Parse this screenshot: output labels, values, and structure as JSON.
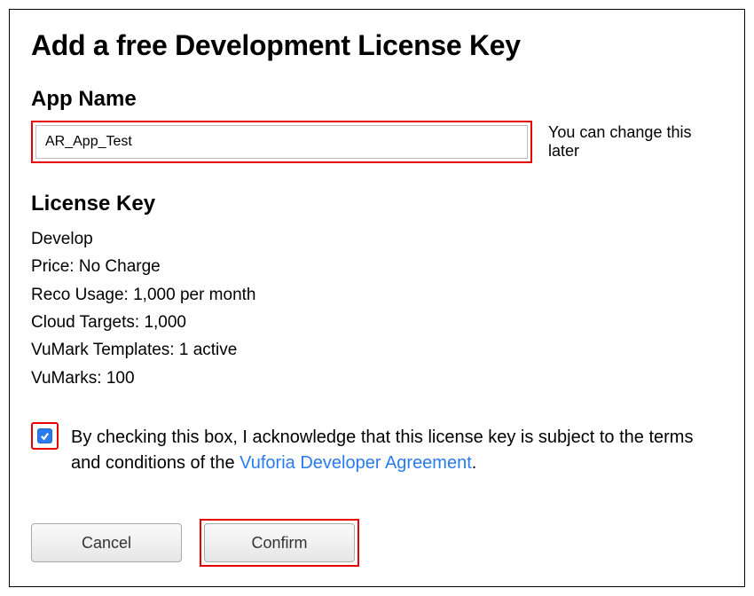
{
  "title": "Add a free Development License Key",
  "appName": {
    "label": "App Name",
    "value": "AR_App_Test",
    "hint": "You can change this later"
  },
  "licenseKey": {
    "label": "License Key",
    "tier": "Develop",
    "price": "Price: No Charge",
    "reco": "Reco Usage: 1,000 per month",
    "cloud": "Cloud Targets: 1,000",
    "vumarkTemplates": "VuMark Templates: 1 active",
    "vumarks": "VuMarks: 100"
  },
  "agreement": {
    "prefix": "By checking this box, I acknowledge that this license key is subject to the terms and conditions of the ",
    "linkText": "Vuforia Developer Agreement",
    "suffix": "."
  },
  "buttons": {
    "cancel": "Cancel",
    "confirm": "Confirm"
  }
}
